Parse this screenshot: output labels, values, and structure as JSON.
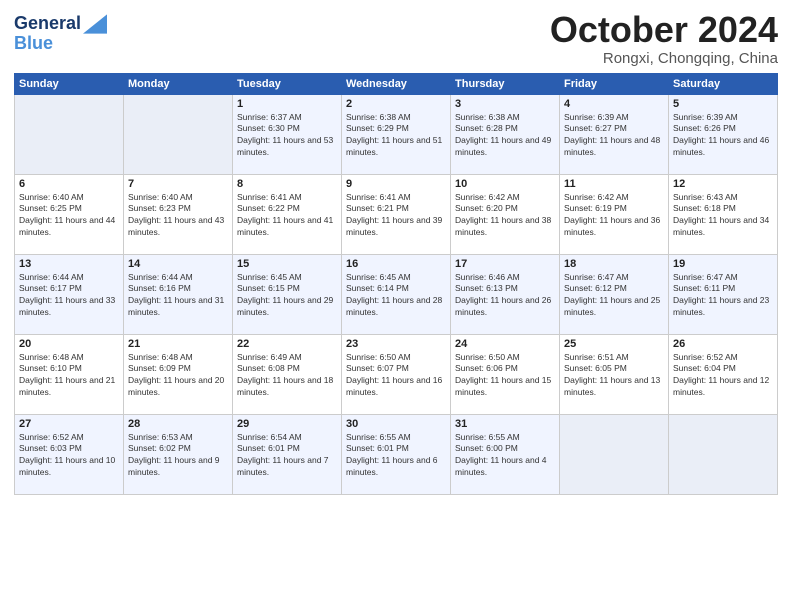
{
  "header": {
    "logo_line1": "General",
    "logo_line2": "Blue",
    "month": "October 2024",
    "location": "Rongxi, Chongqing, China"
  },
  "columns": [
    "Sunday",
    "Monday",
    "Tuesday",
    "Wednesday",
    "Thursday",
    "Friday",
    "Saturday"
  ],
  "weeks": [
    [
      {
        "day": "",
        "info": ""
      },
      {
        "day": "",
        "info": ""
      },
      {
        "day": "1",
        "info": "Sunrise: 6:37 AM\nSunset: 6:30 PM\nDaylight: 11 hours and 53 minutes."
      },
      {
        "day": "2",
        "info": "Sunrise: 6:38 AM\nSunset: 6:29 PM\nDaylight: 11 hours and 51 minutes."
      },
      {
        "day": "3",
        "info": "Sunrise: 6:38 AM\nSunset: 6:28 PM\nDaylight: 11 hours and 49 minutes."
      },
      {
        "day": "4",
        "info": "Sunrise: 6:39 AM\nSunset: 6:27 PM\nDaylight: 11 hours and 48 minutes."
      },
      {
        "day": "5",
        "info": "Sunrise: 6:39 AM\nSunset: 6:26 PM\nDaylight: 11 hours and 46 minutes."
      }
    ],
    [
      {
        "day": "6",
        "info": "Sunrise: 6:40 AM\nSunset: 6:25 PM\nDaylight: 11 hours and 44 minutes."
      },
      {
        "day": "7",
        "info": "Sunrise: 6:40 AM\nSunset: 6:23 PM\nDaylight: 11 hours and 43 minutes."
      },
      {
        "day": "8",
        "info": "Sunrise: 6:41 AM\nSunset: 6:22 PM\nDaylight: 11 hours and 41 minutes."
      },
      {
        "day": "9",
        "info": "Sunrise: 6:41 AM\nSunset: 6:21 PM\nDaylight: 11 hours and 39 minutes."
      },
      {
        "day": "10",
        "info": "Sunrise: 6:42 AM\nSunset: 6:20 PM\nDaylight: 11 hours and 38 minutes."
      },
      {
        "day": "11",
        "info": "Sunrise: 6:42 AM\nSunset: 6:19 PM\nDaylight: 11 hours and 36 minutes."
      },
      {
        "day": "12",
        "info": "Sunrise: 6:43 AM\nSunset: 6:18 PM\nDaylight: 11 hours and 34 minutes."
      }
    ],
    [
      {
        "day": "13",
        "info": "Sunrise: 6:44 AM\nSunset: 6:17 PM\nDaylight: 11 hours and 33 minutes."
      },
      {
        "day": "14",
        "info": "Sunrise: 6:44 AM\nSunset: 6:16 PM\nDaylight: 11 hours and 31 minutes."
      },
      {
        "day": "15",
        "info": "Sunrise: 6:45 AM\nSunset: 6:15 PM\nDaylight: 11 hours and 29 minutes."
      },
      {
        "day": "16",
        "info": "Sunrise: 6:45 AM\nSunset: 6:14 PM\nDaylight: 11 hours and 28 minutes."
      },
      {
        "day": "17",
        "info": "Sunrise: 6:46 AM\nSunset: 6:13 PM\nDaylight: 11 hours and 26 minutes."
      },
      {
        "day": "18",
        "info": "Sunrise: 6:47 AM\nSunset: 6:12 PM\nDaylight: 11 hours and 25 minutes."
      },
      {
        "day": "19",
        "info": "Sunrise: 6:47 AM\nSunset: 6:11 PM\nDaylight: 11 hours and 23 minutes."
      }
    ],
    [
      {
        "day": "20",
        "info": "Sunrise: 6:48 AM\nSunset: 6:10 PM\nDaylight: 11 hours and 21 minutes."
      },
      {
        "day": "21",
        "info": "Sunrise: 6:48 AM\nSunset: 6:09 PM\nDaylight: 11 hours and 20 minutes."
      },
      {
        "day": "22",
        "info": "Sunrise: 6:49 AM\nSunset: 6:08 PM\nDaylight: 11 hours and 18 minutes."
      },
      {
        "day": "23",
        "info": "Sunrise: 6:50 AM\nSunset: 6:07 PM\nDaylight: 11 hours and 16 minutes."
      },
      {
        "day": "24",
        "info": "Sunrise: 6:50 AM\nSunset: 6:06 PM\nDaylight: 11 hours and 15 minutes."
      },
      {
        "day": "25",
        "info": "Sunrise: 6:51 AM\nSunset: 6:05 PM\nDaylight: 11 hours and 13 minutes."
      },
      {
        "day": "26",
        "info": "Sunrise: 6:52 AM\nSunset: 6:04 PM\nDaylight: 11 hours and 12 minutes."
      }
    ],
    [
      {
        "day": "27",
        "info": "Sunrise: 6:52 AM\nSunset: 6:03 PM\nDaylight: 11 hours and 10 minutes."
      },
      {
        "day": "28",
        "info": "Sunrise: 6:53 AM\nSunset: 6:02 PM\nDaylight: 11 hours and 9 minutes."
      },
      {
        "day": "29",
        "info": "Sunrise: 6:54 AM\nSunset: 6:01 PM\nDaylight: 11 hours and 7 minutes."
      },
      {
        "day": "30",
        "info": "Sunrise: 6:55 AM\nSunset: 6:01 PM\nDaylight: 11 hours and 6 minutes."
      },
      {
        "day": "31",
        "info": "Sunrise: 6:55 AM\nSunset: 6:00 PM\nDaylight: 11 hours and 4 minutes."
      },
      {
        "day": "",
        "info": ""
      },
      {
        "day": "",
        "info": ""
      }
    ]
  ]
}
